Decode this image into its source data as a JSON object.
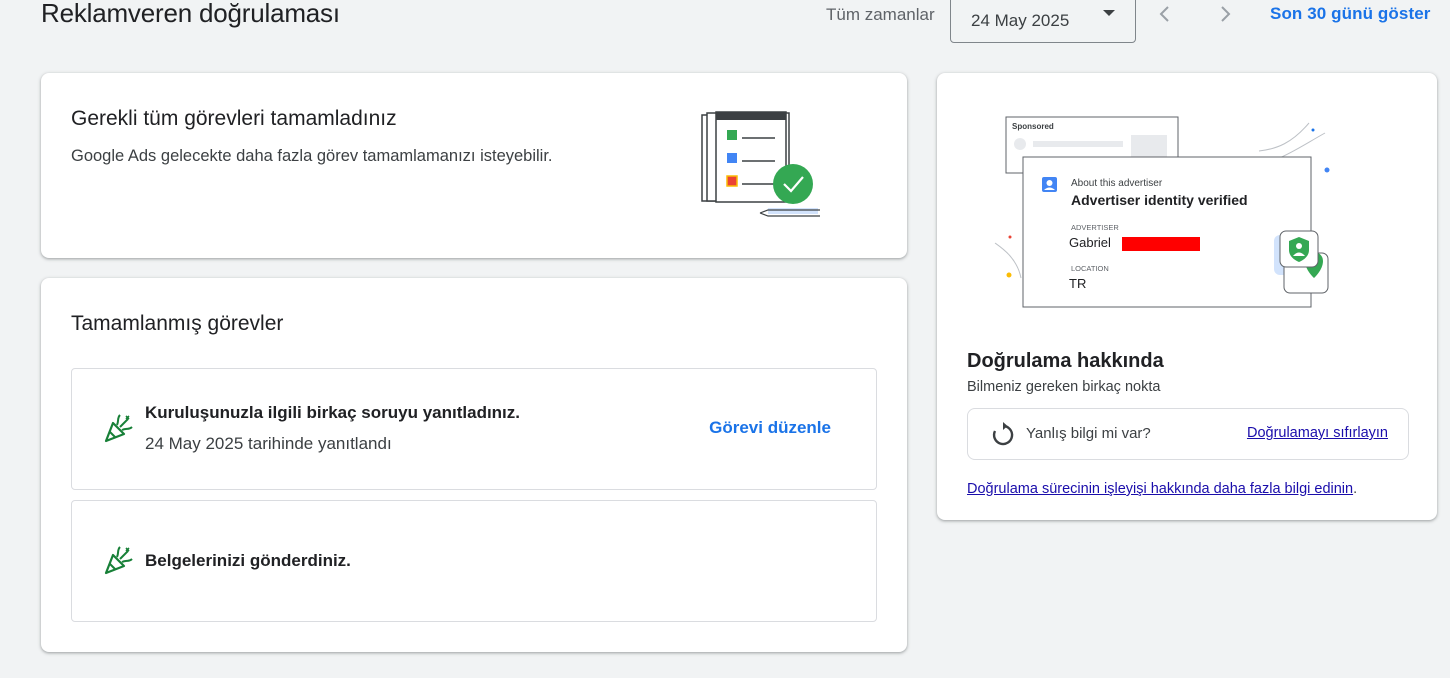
{
  "header": {
    "title": "Reklamveren doğrulaması",
    "range_label": "Tüm zamanlar",
    "date_value": "24 May 2025",
    "show_last_30": "Son 30 günü göster"
  },
  "completion_card": {
    "title": "Gerekli tüm görevleri tamamladınız",
    "subtitle": "Google Ads gelecekte daha fazla görev tamamlamanızı isteyebilir."
  },
  "tasks_card": {
    "title": "Tamamlanmış görevler",
    "tasks": [
      {
        "title": "Kuruluşunuzla ilgili birkaç soruyu yanıtladınız.",
        "date": "24 May 2025 tarihinde yanıtlandı",
        "action": "Görevi düzenle"
      },
      {
        "title": "Belgelerinizi gönderdiniz."
      }
    ]
  },
  "about_card": {
    "illustration": {
      "sponsored": "Sponsored",
      "about_advertiser": "About this advertiser",
      "verified": "Advertiser identity verified",
      "advertiser_label": "ADVERTISER",
      "advertiser_name": "Gabriel",
      "location_label": "LOCATION",
      "location_value": "TR"
    },
    "title": "Doğrulama hakkında",
    "subtitle": "Bilmeniz gereken birkaç nokta",
    "wrong_info": "Yanlış bilgi mi var?",
    "reset_link": "Doğrulamayı sıfırlayın",
    "learn_more": "Doğrulama sürecinin işleyişi hakkında daha fazla bilgi edinin",
    "learn_more_suffix": "."
  },
  "colors": {
    "accent": "#1a73e8",
    "success": "#34a853",
    "link": "#1a0dab",
    "redaction": "#ff0000"
  }
}
